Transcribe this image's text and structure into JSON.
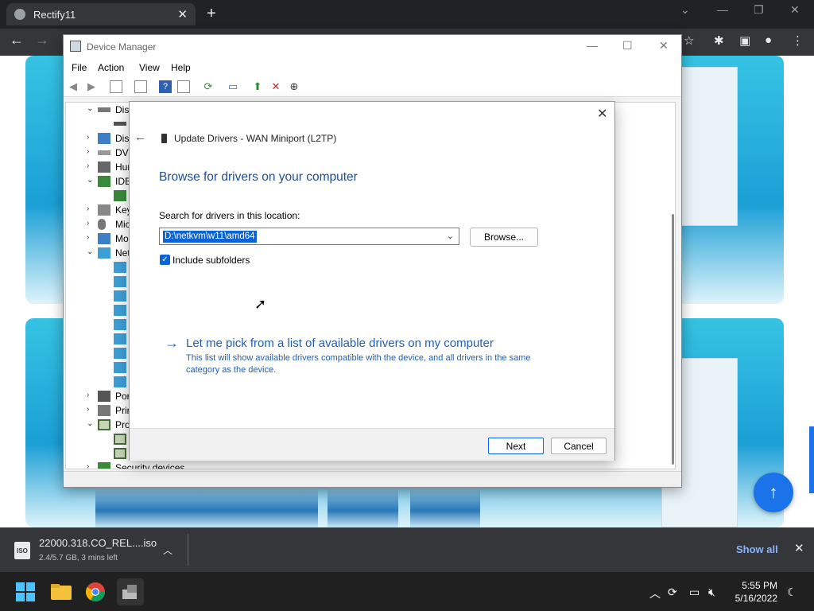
{
  "browser": {
    "tab_title": "Rectify11",
    "tab_close": "✕",
    "new_tab": "+",
    "controls": [
      "⌄",
      "—",
      "❐",
      "✕"
    ]
  },
  "device_manager": {
    "title": "Device Manager",
    "menu": [
      "File",
      "Action",
      "View",
      "Help"
    ],
    "window_controls": [
      "—",
      "☐",
      "✕"
    ],
    "tree": [
      {
        "label": "Disk",
        "expanded": true
      },
      {
        "label": "Disp",
        "expanded": false
      },
      {
        "label": "DVD",
        "expanded": false
      },
      {
        "label": "Hum",
        "expanded": false
      },
      {
        "label": "IDE",
        "expanded": true
      },
      {
        "label": "Key",
        "expanded": false
      },
      {
        "label": "Mic",
        "expanded": false
      },
      {
        "label": "Mo",
        "expanded": false
      },
      {
        "label": "Net",
        "expanded": true
      },
      {
        "label": "Port",
        "expanded": false
      },
      {
        "label": "Prin",
        "expanded": false
      },
      {
        "label": "Pro",
        "expanded": true
      },
      {
        "label": "Security devices",
        "expanded": false
      }
    ]
  },
  "dialog": {
    "header": "Update Drivers - WAN Miniport (L2TP)",
    "heading": "Browse for drivers on your computer",
    "search_label": "Search for drivers in this location:",
    "path_value": "D:\\netkvm\\w11\\amd64",
    "browse_label": "Browse...",
    "include_subfolders": "Include subfolders",
    "pick_link": "Let me pick from a list of available drivers on my computer",
    "pick_desc": "This list will show available drivers compatible with the device, and all drivers in the same category as the device.",
    "next_label": "Next",
    "cancel_label": "Cancel",
    "close": "✕",
    "back": "←"
  },
  "download": {
    "file_name": "22000.318.CO_REL....iso",
    "status": "2.4/5.7 GB, 3 mins left",
    "icon_text": "ISO",
    "show_all": "Show all",
    "close": "✕"
  },
  "taskbar": {
    "time": "5:55 PM",
    "date": "5/16/2022"
  },
  "colors": {
    "accent": "#0a64d8",
    "link": "#1f5fb8",
    "heading": "#1f4e9a"
  }
}
